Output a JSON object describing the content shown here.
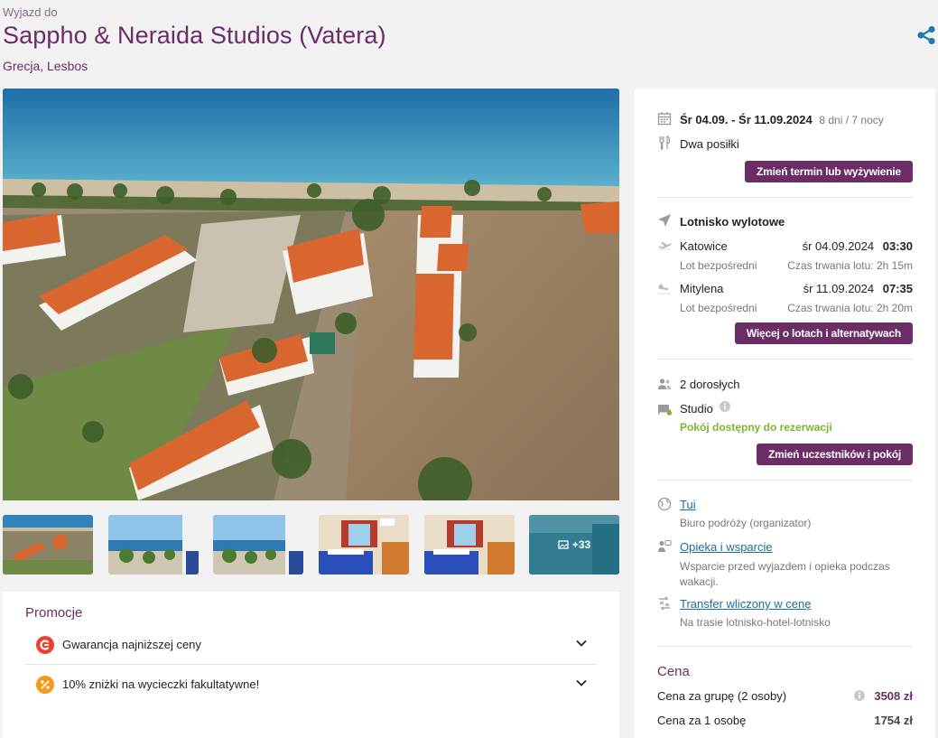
{
  "header": {
    "pre_title": "Wyjazd do",
    "title": "Sappho & Neraida Studios (Vatera)",
    "location": "Grecja, Lesbos"
  },
  "gallery": {
    "more_label": "+33"
  },
  "promo": {
    "title": "Promocje",
    "items": [
      {
        "label": "Gwarancja najniższej ceny"
      },
      {
        "label": "10% zniżki na wycieczki fakultatywne!"
      }
    ]
  },
  "trip": {
    "dates": "Śr 04.09. - Śr 11.09.2024",
    "duration": "8 dni / 7 nocy",
    "board": "Dwa posiłki",
    "change_button": "Zmień termin lub wyżywienie"
  },
  "flights": {
    "title": "Lotnisko wylotowe",
    "outbound": {
      "city": "Katowice",
      "date": "śr 04.09.2024",
      "time": "03:30",
      "type": "Lot bezpośredni",
      "duration": "Czas trwania lotu: 2h 15m"
    },
    "return": {
      "city": "Mitylena",
      "date": "śr 11.09.2024",
      "time": "07:35",
      "type": "Lot bezpośredni",
      "duration": "Czas trwania lotu: 2h 20m"
    },
    "more_button": "Więcej o lotach i alternatywach"
  },
  "room": {
    "adults": "2 dorosłych",
    "type": "Studio",
    "availability": "Pokój dostępny do rezerwacji",
    "change_button": "Zmień uczestników i pokój"
  },
  "services": {
    "organizer_link": "Tui",
    "organizer_desc": "Biuro podróży (organizator)",
    "care_link": "Opieka i wsparcie",
    "care_desc": "Wsparcie przed wyjazdem i opieka podczas wakacji.",
    "transfer_link": "Transfer wliczony w cenę",
    "transfer_desc": "Na trasie lotnisko-hotel-lotnisko"
  },
  "price": {
    "title": "Cena",
    "group_label": "Cena za grupę (2 osoby)",
    "group_value": "3508 zł",
    "person_label": "Cena za 1 osobę",
    "person_value": "1754 zł"
  },
  "colors": {
    "brand": "#6c2d67",
    "link": "#1e6c9a",
    "available": "#7ab62d",
    "share": "#1f7aa8"
  }
}
